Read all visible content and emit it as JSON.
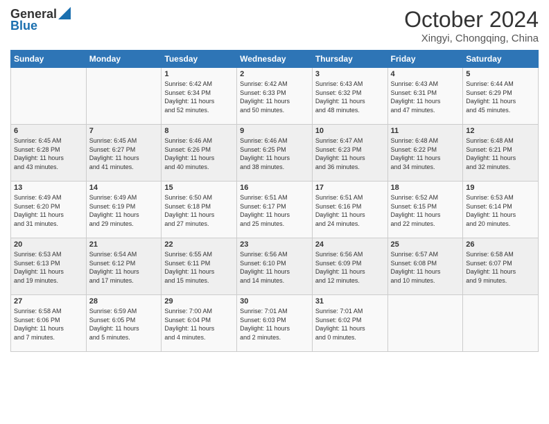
{
  "logo": {
    "line1": "General",
    "line2": "Blue"
  },
  "header": {
    "month_year": "October 2024",
    "location": "Xingyi, Chongqing, China"
  },
  "weekdays": [
    "Sunday",
    "Monday",
    "Tuesday",
    "Wednesday",
    "Thursday",
    "Friday",
    "Saturday"
  ],
  "weeks": [
    [
      {
        "day": "",
        "info": ""
      },
      {
        "day": "",
        "info": ""
      },
      {
        "day": "1",
        "info": "Sunrise: 6:42 AM\nSunset: 6:34 PM\nDaylight: 11 hours\nand 52 minutes."
      },
      {
        "day": "2",
        "info": "Sunrise: 6:42 AM\nSunset: 6:33 PM\nDaylight: 11 hours\nand 50 minutes."
      },
      {
        "day": "3",
        "info": "Sunrise: 6:43 AM\nSunset: 6:32 PM\nDaylight: 11 hours\nand 48 minutes."
      },
      {
        "day": "4",
        "info": "Sunrise: 6:43 AM\nSunset: 6:31 PM\nDaylight: 11 hours\nand 47 minutes."
      },
      {
        "day": "5",
        "info": "Sunrise: 6:44 AM\nSunset: 6:29 PM\nDaylight: 11 hours\nand 45 minutes."
      }
    ],
    [
      {
        "day": "6",
        "info": "Sunrise: 6:45 AM\nSunset: 6:28 PM\nDaylight: 11 hours\nand 43 minutes."
      },
      {
        "day": "7",
        "info": "Sunrise: 6:45 AM\nSunset: 6:27 PM\nDaylight: 11 hours\nand 41 minutes."
      },
      {
        "day": "8",
        "info": "Sunrise: 6:46 AM\nSunset: 6:26 PM\nDaylight: 11 hours\nand 40 minutes."
      },
      {
        "day": "9",
        "info": "Sunrise: 6:46 AM\nSunset: 6:25 PM\nDaylight: 11 hours\nand 38 minutes."
      },
      {
        "day": "10",
        "info": "Sunrise: 6:47 AM\nSunset: 6:23 PM\nDaylight: 11 hours\nand 36 minutes."
      },
      {
        "day": "11",
        "info": "Sunrise: 6:48 AM\nSunset: 6:22 PM\nDaylight: 11 hours\nand 34 minutes."
      },
      {
        "day": "12",
        "info": "Sunrise: 6:48 AM\nSunset: 6:21 PM\nDaylight: 11 hours\nand 32 minutes."
      }
    ],
    [
      {
        "day": "13",
        "info": "Sunrise: 6:49 AM\nSunset: 6:20 PM\nDaylight: 11 hours\nand 31 minutes."
      },
      {
        "day": "14",
        "info": "Sunrise: 6:49 AM\nSunset: 6:19 PM\nDaylight: 11 hours\nand 29 minutes."
      },
      {
        "day": "15",
        "info": "Sunrise: 6:50 AM\nSunset: 6:18 PM\nDaylight: 11 hours\nand 27 minutes."
      },
      {
        "day": "16",
        "info": "Sunrise: 6:51 AM\nSunset: 6:17 PM\nDaylight: 11 hours\nand 25 minutes."
      },
      {
        "day": "17",
        "info": "Sunrise: 6:51 AM\nSunset: 6:16 PM\nDaylight: 11 hours\nand 24 minutes."
      },
      {
        "day": "18",
        "info": "Sunrise: 6:52 AM\nSunset: 6:15 PM\nDaylight: 11 hours\nand 22 minutes."
      },
      {
        "day": "19",
        "info": "Sunrise: 6:53 AM\nSunset: 6:14 PM\nDaylight: 11 hours\nand 20 minutes."
      }
    ],
    [
      {
        "day": "20",
        "info": "Sunrise: 6:53 AM\nSunset: 6:13 PM\nDaylight: 11 hours\nand 19 minutes."
      },
      {
        "day": "21",
        "info": "Sunrise: 6:54 AM\nSunset: 6:12 PM\nDaylight: 11 hours\nand 17 minutes."
      },
      {
        "day": "22",
        "info": "Sunrise: 6:55 AM\nSunset: 6:11 PM\nDaylight: 11 hours\nand 15 minutes."
      },
      {
        "day": "23",
        "info": "Sunrise: 6:56 AM\nSunset: 6:10 PM\nDaylight: 11 hours\nand 14 minutes."
      },
      {
        "day": "24",
        "info": "Sunrise: 6:56 AM\nSunset: 6:09 PM\nDaylight: 11 hours\nand 12 minutes."
      },
      {
        "day": "25",
        "info": "Sunrise: 6:57 AM\nSunset: 6:08 PM\nDaylight: 11 hours\nand 10 minutes."
      },
      {
        "day": "26",
        "info": "Sunrise: 6:58 AM\nSunset: 6:07 PM\nDaylight: 11 hours\nand 9 minutes."
      }
    ],
    [
      {
        "day": "27",
        "info": "Sunrise: 6:58 AM\nSunset: 6:06 PM\nDaylight: 11 hours\nand 7 minutes."
      },
      {
        "day": "28",
        "info": "Sunrise: 6:59 AM\nSunset: 6:05 PM\nDaylight: 11 hours\nand 5 minutes."
      },
      {
        "day": "29",
        "info": "Sunrise: 7:00 AM\nSunset: 6:04 PM\nDaylight: 11 hours\nand 4 minutes."
      },
      {
        "day": "30",
        "info": "Sunrise: 7:01 AM\nSunset: 6:03 PM\nDaylight: 11 hours\nand 2 minutes."
      },
      {
        "day": "31",
        "info": "Sunrise: 7:01 AM\nSunset: 6:02 PM\nDaylight: 11 hours\nand 0 minutes."
      },
      {
        "day": "",
        "info": ""
      },
      {
        "day": "",
        "info": ""
      }
    ]
  ]
}
